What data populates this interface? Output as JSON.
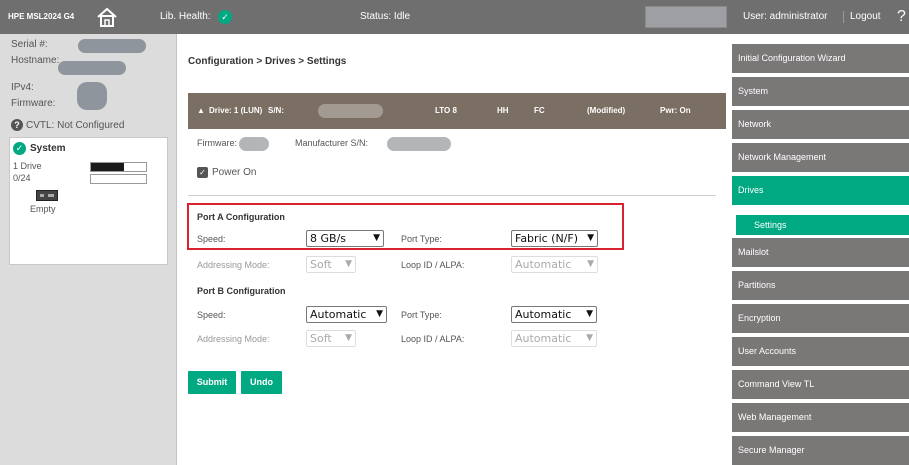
{
  "topbar": {
    "model": "HPE MSL2024 G4",
    "health_label": "Lib. Health:",
    "status_label": "Status:",
    "status_value": "Idle",
    "user": "User: administrator",
    "logout": "Logout",
    "help": "?"
  },
  "left": {
    "serial_label": "Serial #:",
    "hostname_label": "Hostname:",
    "ipv4_label": "IPv4:",
    "firmware_label": "Firmware:",
    "cvtl": "CVTL: Not Configured",
    "system_title": "System",
    "drives_text": "1 Drive",
    "drives_fraction": 0.6,
    "slots_text": "0/24",
    "slots_fraction": 0,
    "empty_label": "Empty"
  },
  "main": {
    "breadcrumb": "Configuration > Drives > Settings",
    "drive_bar": {
      "arrow": "▲",
      "drive": "Drive: 1 (LUN)",
      "sn_label": "S/N:",
      "type": "LTO 8",
      "form": "HH",
      "interface": "FC",
      "modified": "(Modified)",
      "power": "Pwr: On"
    },
    "firmware_label": "Firmware:",
    "manufacturer_sn_label": "Manufacturer S/N:",
    "power_on_label": "Power On",
    "port_a": {
      "title": "Port A Configuration",
      "speed_label": "Speed:",
      "speed_value": "8 GB/s",
      "port_type_label": "Port Type:",
      "port_type_value": "Fabric (N/F)",
      "addressing_label": "Addressing Mode:",
      "addressing_value": "Soft",
      "loop_label": "Loop ID / ALPA:",
      "loop_value": "Automatic"
    },
    "port_b": {
      "title": "Port B Configuration",
      "speed_label": "Speed:",
      "speed_value": "Automatic",
      "port_type_label": "Port Type:",
      "port_type_value": "Automatic",
      "addressing_label": "Addressing Mode:",
      "addressing_value": "Soft",
      "loop_label": "Loop ID / ALPA:",
      "loop_value": "Automatic"
    },
    "submit": "Submit",
    "undo": "Undo"
  },
  "nav": {
    "items": [
      "Initial Configuration Wizard",
      "System",
      "Network",
      "Network Management",
      "Drives",
      "Settings",
      "Mailslot",
      "Partitions",
      "Encryption",
      "User Accounts",
      "Command View TL",
      "Web Management",
      "Secure Manager"
    ],
    "active": "Drives",
    "active_sub": "Settings"
  },
  "colors": {
    "accent_green": "#01a982",
    "topbar": "#6f6f6f",
    "nav_item": "#7a7777",
    "drive_bar": "#7b6e63",
    "highlight_red": "#d9232e"
  }
}
